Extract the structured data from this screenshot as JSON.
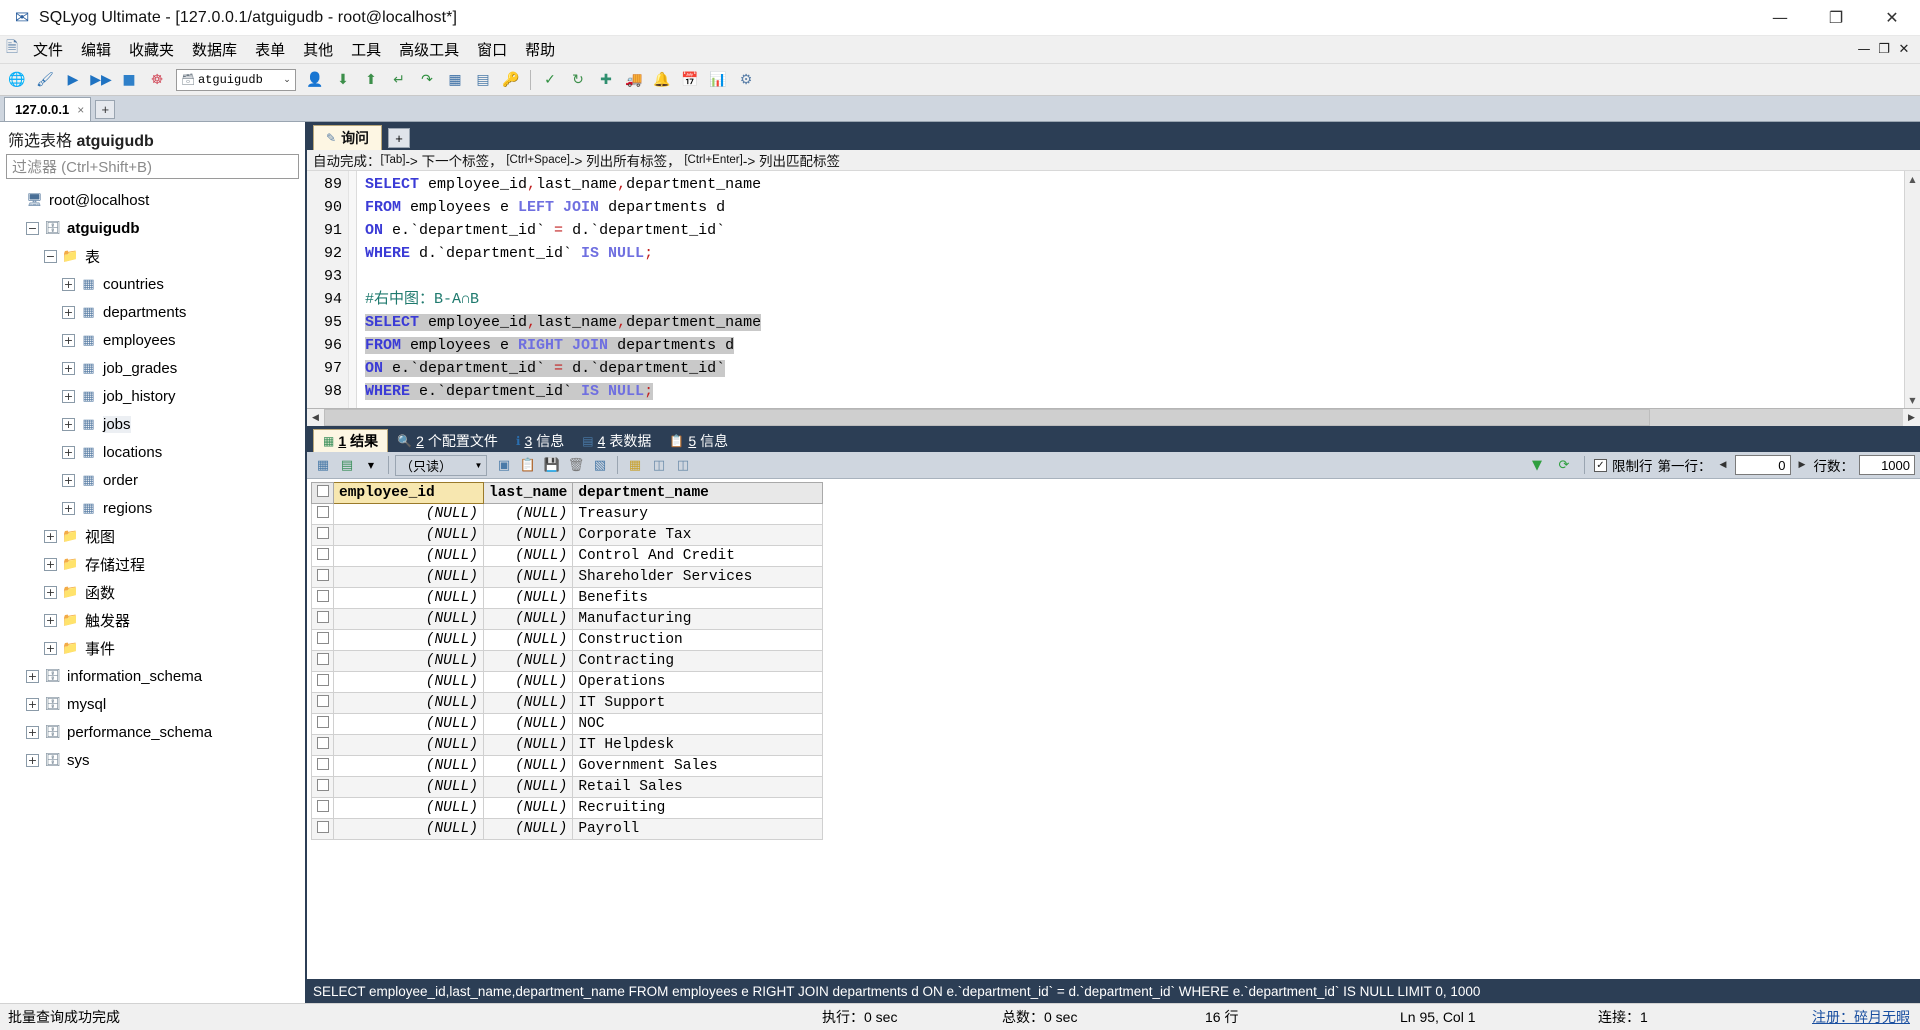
{
  "window": {
    "title": "SQLyog Ultimate - [127.0.0.1/atguigudb - root@localhost*]",
    "app_icon": "sqlyog-icon",
    "minimize": "—",
    "maximize": "❐",
    "close": "✕",
    "mdi_minimize": "—",
    "mdi_restore": "❐",
    "mdi_close": "✕"
  },
  "menubar": {
    "items": [
      "文件",
      "编辑",
      "收藏夹",
      "数据库",
      "表单",
      "其他",
      "工具",
      "高级工具",
      "窗口",
      "帮助"
    ]
  },
  "toolbar": {
    "db_selected": "atguigudb",
    "dropdown_arrow": "⌄"
  },
  "connection_tabs": {
    "tabs": [
      {
        "label": "127.0.0.1",
        "close": "×"
      }
    ],
    "add_label": "+"
  },
  "sidebar": {
    "filter_title_prefix": "筛选表格 ",
    "filter_title_db": "atguigudb",
    "filter_placeholder": "过滤器 (Ctrl+Shift+B)",
    "tree": [
      {
        "label": "root@localhost",
        "icon": "server-icon",
        "indent": 0,
        "expander": "",
        "bold": false
      },
      {
        "label": "atguigudb",
        "icon": "database-icon",
        "indent": 1,
        "expander": "−",
        "bold": true
      },
      {
        "label": "表",
        "icon": "folder-icon",
        "indent": 2,
        "expander": "−",
        "bold": false
      },
      {
        "label": "countries",
        "icon": "table-icon",
        "indent": 3,
        "expander": "+",
        "bold": false
      },
      {
        "label": "departments",
        "icon": "table-icon",
        "indent": 3,
        "expander": "+",
        "bold": false
      },
      {
        "label": "employees",
        "icon": "table-icon",
        "indent": 3,
        "expander": "+",
        "bold": false
      },
      {
        "label": "job_grades",
        "icon": "table-icon",
        "indent": 3,
        "expander": "+",
        "bold": false
      },
      {
        "label": "job_history",
        "icon": "table-icon",
        "indent": 3,
        "expander": "+",
        "bold": false
      },
      {
        "label": "jobs",
        "icon": "table-icon",
        "indent": 3,
        "expander": "+",
        "bold": false,
        "highlight": true
      },
      {
        "label": "locations",
        "icon": "table-icon",
        "indent": 3,
        "expander": "+",
        "bold": false
      },
      {
        "label": "order",
        "icon": "table-icon",
        "indent": 3,
        "expander": "+",
        "bold": false
      },
      {
        "label": "regions",
        "icon": "table-icon",
        "indent": 3,
        "expander": "+",
        "bold": false
      },
      {
        "label": "视图",
        "icon": "folder-icon",
        "indent": 2,
        "expander": "+",
        "bold": false
      },
      {
        "label": "存储过程",
        "icon": "folder-icon",
        "indent": 2,
        "expander": "+",
        "bold": false
      },
      {
        "label": "函数",
        "icon": "folder-icon",
        "indent": 2,
        "expander": "+",
        "bold": false
      },
      {
        "label": "触发器",
        "icon": "folder-icon",
        "indent": 2,
        "expander": "+",
        "bold": false
      },
      {
        "label": "事件",
        "icon": "folder-icon",
        "indent": 2,
        "expander": "+",
        "bold": false
      },
      {
        "label": "information_schema",
        "icon": "database-icon",
        "indent": 1,
        "expander": "+",
        "bold": false
      },
      {
        "label": "mysql",
        "icon": "database-icon",
        "indent": 1,
        "expander": "+",
        "bold": false
      },
      {
        "label": "performance_schema",
        "icon": "database-icon",
        "indent": 1,
        "expander": "+",
        "bold": false
      },
      {
        "label": "sys",
        "icon": "database-icon",
        "indent": 1,
        "expander": "+",
        "bold": false
      }
    ]
  },
  "query_tabs": {
    "tabs": [
      {
        "label": "询问",
        "icon": "query-icon"
      }
    ],
    "add_label": "+"
  },
  "autocomplete_hint": {
    "prefix": "自动完成：",
    "parts": [
      {
        "key": "[Tab]",
        "text": "-> 下一个标签，"
      },
      {
        "key": "[Ctrl+Space]",
        "text": "-> 列出所有标签，"
      },
      {
        "key": "[Ctrl+Enter]",
        "text": "-> 列出匹配标签"
      }
    ]
  },
  "editor": {
    "first_line_number": 89,
    "lines": [
      {
        "n": 89,
        "selected": false,
        "tokens": [
          {
            "t": "SELECT",
            "c": "kw"
          },
          {
            "t": " employee_id",
            "c": "ident"
          },
          {
            "t": ",",
            "c": "punct"
          },
          {
            "t": "last_name",
            "c": "ident"
          },
          {
            "t": ",",
            "c": "punct"
          },
          {
            "t": "department_name",
            "c": "ident"
          }
        ]
      },
      {
        "n": 90,
        "selected": false,
        "tokens": [
          {
            "t": "FROM",
            "c": "kw"
          },
          {
            "t": " employees e ",
            "c": "ident"
          },
          {
            "t": "LEFT JOIN",
            "c": "kw2"
          },
          {
            "t": " departments d",
            "c": "ident"
          }
        ]
      },
      {
        "n": 91,
        "selected": false,
        "tokens": [
          {
            "t": "ON",
            "c": "kw"
          },
          {
            "t": " e.`department_id` ",
            "c": "ident"
          },
          {
            "t": "=",
            "c": "punct"
          },
          {
            "t": " d.`department_id`",
            "c": "ident"
          }
        ]
      },
      {
        "n": 92,
        "selected": false,
        "tokens": [
          {
            "t": "WHERE",
            "c": "kw"
          },
          {
            "t": " d.`department_id` ",
            "c": "ident"
          },
          {
            "t": "IS NULL",
            "c": "kw2"
          },
          {
            "t": ";",
            "c": "punct"
          }
        ]
      },
      {
        "n": 93,
        "selected": false,
        "tokens": []
      },
      {
        "n": 94,
        "selected": false,
        "tokens": [
          {
            "t": "#右中图：B-A∩B",
            "c": "cmt"
          }
        ]
      },
      {
        "n": 95,
        "selected": true,
        "tokens": [
          {
            "t": "SELECT",
            "c": "kw"
          },
          {
            "t": " employee_id",
            "c": "ident"
          },
          {
            "t": ",",
            "c": "punct"
          },
          {
            "t": "last_name",
            "c": "ident"
          },
          {
            "t": ",",
            "c": "punct"
          },
          {
            "t": "department_name",
            "c": "ident"
          }
        ]
      },
      {
        "n": 96,
        "selected": true,
        "tokens": [
          {
            "t": "FROM",
            "c": "kw"
          },
          {
            "t": " employees e ",
            "c": "ident"
          },
          {
            "t": "RIGHT JOIN",
            "c": "kw2"
          },
          {
            "t": " departments d",
            "c": "ident"
          }
        ]
      },
      {
        "n": 97,
        "selected": true,
        "tokens": [
          {
            "t": "ON",
            "c": "kw"
          },
          {
            "t": " e.`department_id` ",
            "c": "ident"
          },
          {
            "t": "=",
            "c": "punct"
          },
          {
            "t": " d.`department_id`",
            "c": "ident"
          }
        ]
      },
      {
        "n": 98,
        "selected": true,
        "tokens": [
          {
            "t": "WHERE",
            "c": "kw"
          },
          {
            "t": " e.`department_id` ",
            "c": "ident"
          },
          {
            "t": "IS NULL",
            "c": "kw2"
          },
          {
            "t": ";",
            "c": "punct"
          }
        ]
      }
    ]
  },
  "result_tabs": [
    {
      "num": "1",
      "label": "结果",
      "icon": "grid-icon",
      "active": true
    },
    {
      "num": "2",
      "label": "个配置文件",
      "icon": "profile-icon",
      "active": false
    },
    {
      "num": "3",
      "label": "信息",
      "icon": "info-icon",
      "active": false
    },
    {
      "num": "4",
      "label": "表数据",
      "icon": "table-data-icon",
      "active": false
    },
    {
      "num": "5",
      "label": "信息",
      "icon": "messages-icon",
      "active": false
    }
  ],
  "grid_toolbar": {
    "readonly_label": "（只读）",
    "dropdown_arrow": "⌄",
    "filter_icon": "filter-icon",
    "refresh_icon": "refresh-icon",
    "limit_checkbox_label": "限制行",
    "limit_checked": true,
    "first_row_label": "第一行：",
    "first_row_value": "0",
    "rows_label": "行数：",
    "rows_value": "1000"
  },
  "result_grid": {
    "columns": [
      "employee_id",
      "last_name",
      "department_name"
    ],
    "rows": [
      [
        "(NULL)",
        "(NULL)",
        "Treasury"
      ],
      [
        "(NULL)",
        "(NULL)",
        "Corporate Tax"
      ],
      [
        "(NULL)",
        "(NULL)",
        "Control And Credit"
      ],
      [
        "(NULL)",
        "(NULL)",
        "Shareholder Services"
      ],
      [
        "(NULL)",
        "(NULL)",
        "Benefits"
      ],
      [
        "(NULL)",
        "(NULL)",
        "Manufacturing"
      ],
      [
        "(NULL)",
        "(NULL)",
        "Construction"
      ],
      [
        "(NULL)",
        "(NULL)",
        "Contracting"
      ],
      [
        "(NULL)",
        "(NULL)",
        "Operations"
      ],
      [
        "(NULL)",
        "(NULL)",
        "IT Support"
      ],
      [
        "(NULL)",
        "(NULL)",
        "NOC"
      ],
      [
        "(NULL)",
        "(NULL)",
        "IT Helpdesk"
      ],
      [
        "(NULL)",
        "(NULL)",
        "Government Sales"
      ],
      [
        "(NULL)",
        "(NULL)",
        "Retail Sales"
      ],
      [
        "(NULL)",
        "(NULL)",
        "Recruiting"
      ],
      [
        "(NULL)",
        "(NULL)",
        "Payroll"
      ]
    ]
  },
  "query_echo": "SELECT employee_id,last_name,department_name FROM employees e RIGHT JOIN departments d ON e.`department_id` = d.`department_id` WHERE e.`department_id` IS NULL LIMIT 0, 1000",
  "statusbar": {
    "message": "批量查询成功完成",
    "exec_time": "执行：0 sec",
    "total_time": "总数：0 sec",
    "row_count": "16 行",
    "caret": "Ln 95, Col 1",
    "connection": "连接：1",
    "register_link": "注册：碎月无暇"
  }
}
